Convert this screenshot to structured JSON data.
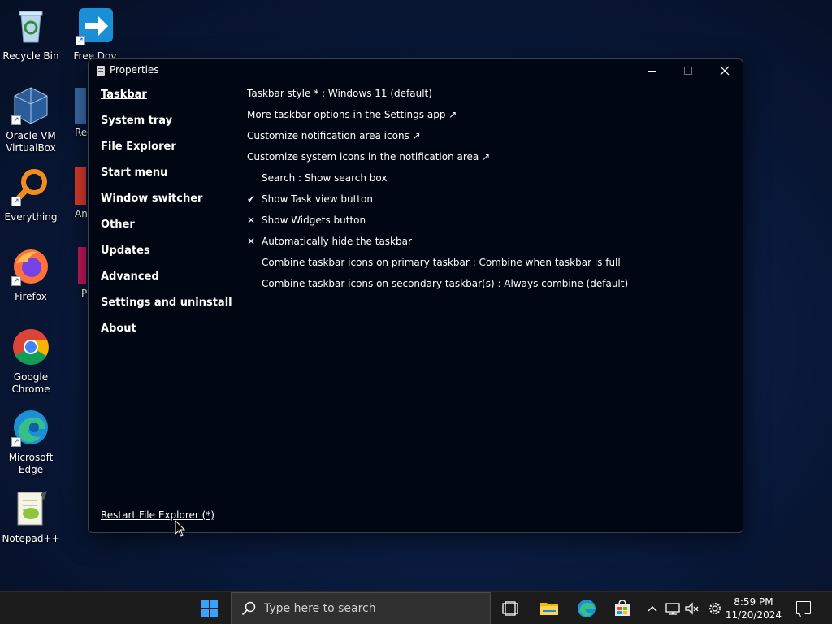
{
  "desktop": {
    "icons": [
      {
        "label": "Recycle Bin"
      },
      {
        "label": "Free Dov"
      },
      {
        "label": "Oracle VM VirtualBox"
      },
      {
        "label": "Rec Co"
      },
      {
        "label": "Everything"
      },
      {
        "label": "An"
      },
      {
        "label": "Firefox"
      },
      {
        "label": "P"
      },
      {
        "label": "Google Chrome"
      },
      {
        "label": "Microsoft Edge"
      },
      {
        "label": "Notepad++"
      }
    ]
  },
  "window": {
    "title": "Properties",
    "nav": [
      {
        "label": "Taskbar",
        "active": true
      },
      {
        "label": "System tray"
      },
      {
        "label": "File Explorer"
      },
      {
        "label": "Start menu"
      },
      {
        "label": "Window switcher"
      },
      {
        "label": "Other"
      },
      {
        "label": "Updates"
      },
      {
        "label": "Advanced"
      },
      {
        "label": "Settings and uninstall"
      },
      {
        "label": "About"
      }
    ],
    "rows": [
      {
        "text": "Taskbar style * : Windows 11 (default)"
      },
      {
        "text": "More taskbar options in the Settings app ↗"
      },
      {
        "text": "Customize notification area icons ↗"
      },
      {
        "text": "Customize system icons in the notification area ↗"
      },
      {
        "text": "Search : Show search box",
        "mark": ""
      },
      {
        "text": "Show Task view button",
        "mark": "✔"
      },
      {
        "text": "Show Widgets button",
        "mark": "✕"
      },
      {
        "text": "Automatically hide the taskbar",
        "mark": "✕"
      },
      {
        "text": "Combine taskbar icons on primary taskbar : Combine when taskbar is full",
        "mark": ""
      },
      {
        "text": "Combine taskbar icons on secondary taskbar(s) : Always combine (default)",
        "mark": ""
      }
    ],
    "restart_link": "Restart File Explorer (*)"
  },
  "taskbar": {
    "search_placeholder": "Type here to search",
    "time": "8:59 PM",
    "date": "11/20/2024",
    "icons": [
      "start-icon",
      "task-view-icon",
      "file-explorer-icon",
      "edge-icon",
      "store-icon",
      "chevron-up-icon",
      "network-icon",
      "volume-muted-icon",
      "settings-gear-icon",
      "notification-icon"
    ]
  }
}
